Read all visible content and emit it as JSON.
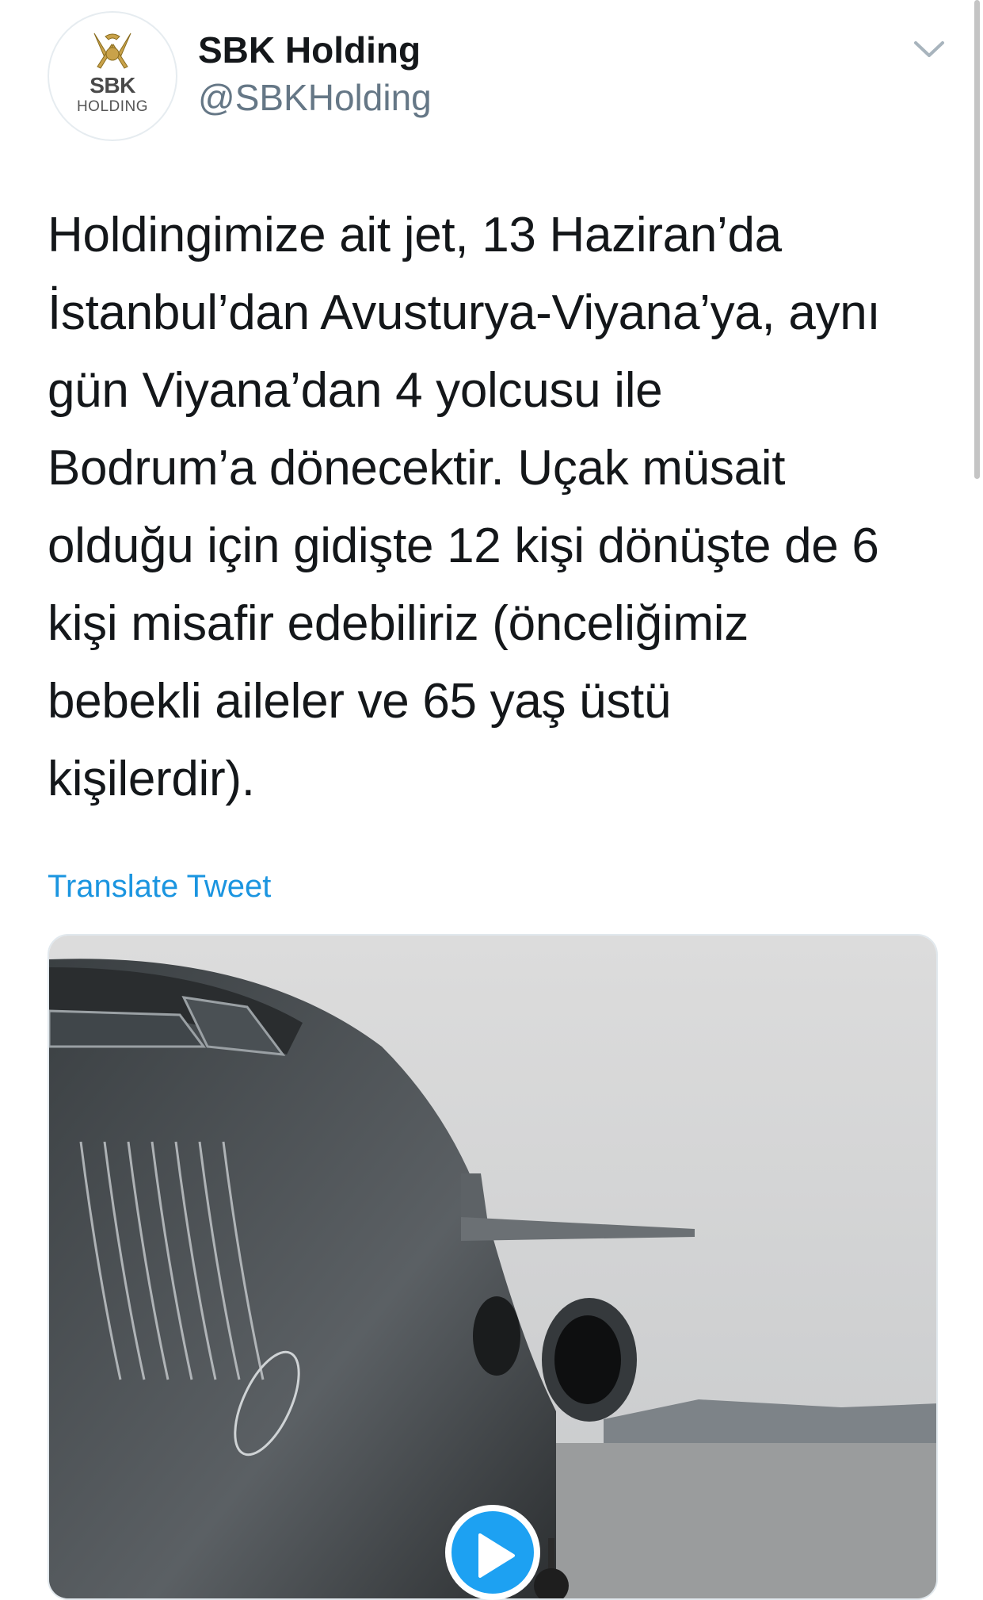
{
  "profile": {
    "avatar_text_top": "SBK",
    "avatar_text_bottom": "HOLDING",
    "display_name": "SBK Holding",
    "handle": "@SBKHolding"
  },
  "tweet": {
    "text": "Holdingimize ait jet, 13 Haziran’da\nİstanbul’dan Avusturya-Viyana’ya, aynı\ngün Viyana’dan  4 yolcusu ile\nBodrum’a dönecektir. Uçak müsait\nolduğu için gidişte 12 kişi dönüşte de 6\nkişi misafir edebiliriz (önceliğimiz\nbebekli aileler ve 65 yaş üstü\nkişilerdir).",
    "translate_label": "Translate Tweet"
  },
  "media": {
    "type": "video",
    "icon": "play-icon"
  },
  "colors": {
    "link": "#1b95e0",
    "accent": "#1da1f2",
    "secondary_text": "#657786"
  }
}
